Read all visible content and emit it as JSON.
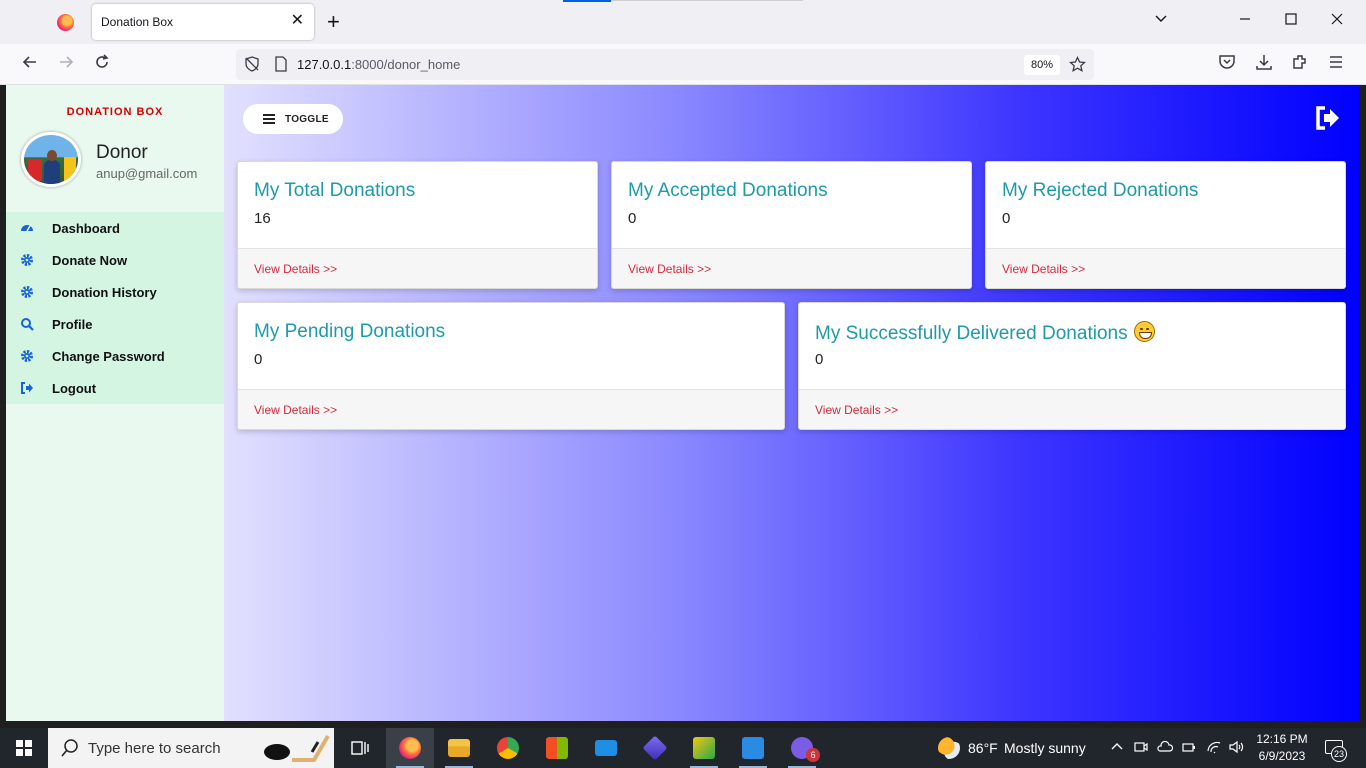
{
  "browser": {
    "tab_title": "Donation Box",
    "url_host": "127.0.0.1",
    "url_path": ":8000/donor_home",
    "zoom": "80%"
  },
  "sidebar": {
    "brand": "DONATION BOX",
    "user_name": "Donor",
    "user_email": "anup@gmail.com",
    "items": [
      {
        "label": "Dashboard",
        "icon": "dashboard-icon"
      },
      {
        "label": "Donate Now",
        "icon": "gear-icon"
      },
      {
        "label": "Donation History",
        "icon": "gear-icon"
      },
      {
        "label": "Profile",
        "icon": "search-icon"
      },
      {
        "label": "Change Password",
        "icon": "gear-icon"
      },
      {
        "label": "Logout",
        "icon": "logout-icon"
      }
    ]
  },
  "main": {
    "toggle_label": "TOGGLE",
    "cards": [
      {
        "title": "My Total Donations",
        "value": "16",
        "link": "View Details >>"
      },
      {
        "title": "My Accepted Donations",
        "value": "0",
        "link": "View Details >>"
      },
      {
        "title": "My Rejected Donations",
        "value": "0",
        "link": "View Details >>"
      },
      {
        "title": "My Pending Donations",
        "value": "0",
        "link": "View Details >>"
      },
      {
        "title": "My Successfully Delivered Donations",
        "value": "0",
        "link": "View Details >>"
      }
    ]
  },
  "taskbar": {
    "search_placeholder": "Type here to search",
    "weather_temp": "86°F",
    "weather_desc": "Mostly sunny",
    "time": "12:16 PM",
    "date": "6/9/2023",
    "mail_badge": "6",
    "notification_count": "23"
  },
  "colors": {
    "card_title": "#1e9aaa",
    "link": "#d6293e",
    "brand": "#d60000",
    "sidebar_bg": "#e9f9ef",
    "menu_bg": "#d5f5e3",
    "gradient_end": "#0000ff"
  }
}
